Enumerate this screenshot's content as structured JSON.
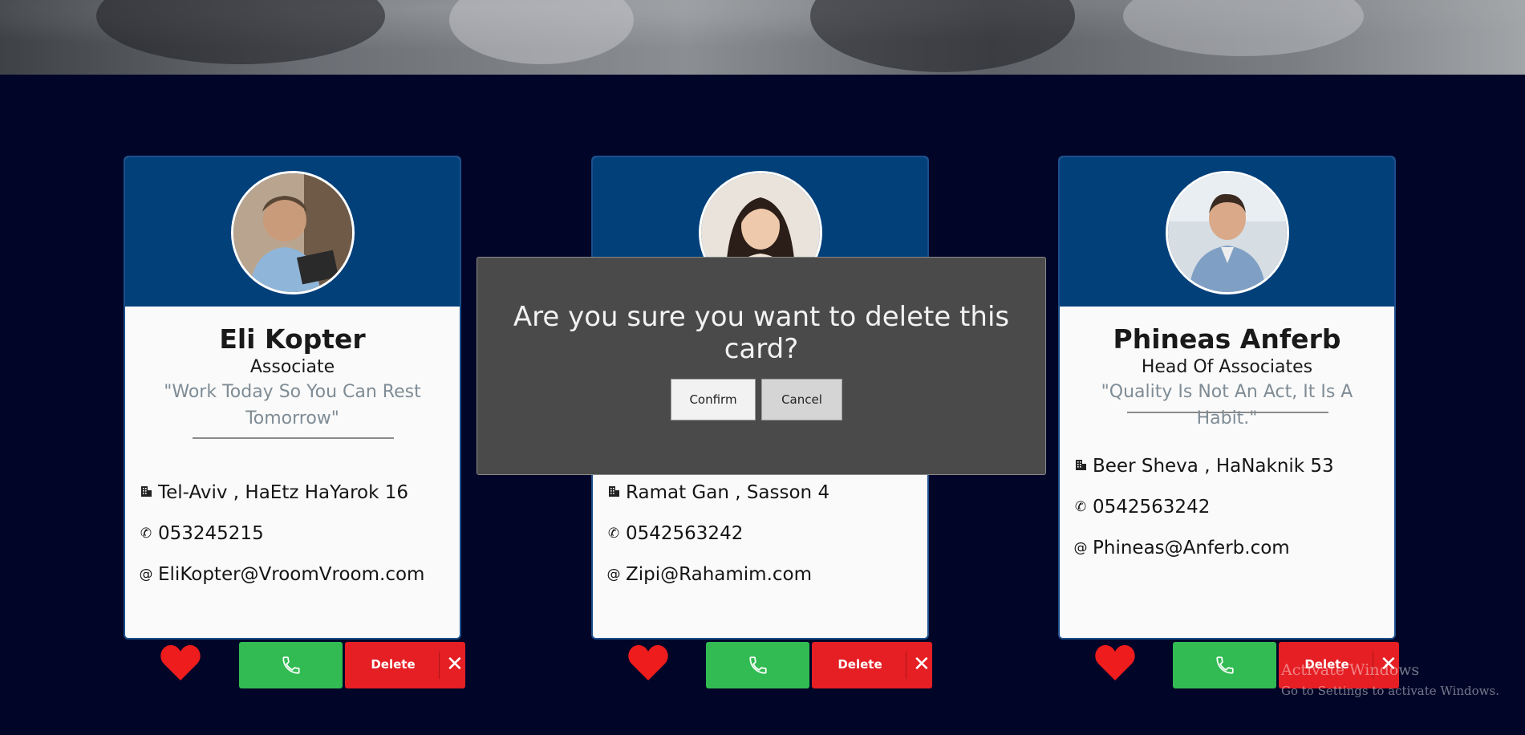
{
  "cards": [
    {
      "name": "Eli Kopter",
      "title": "Associate",
      "quote": "\"Work Today So You Can Rest Tomorrow\"",
      "address": "Tel-Aviv , HaEtz HaYarok 16",
      "phone": "053245215",
      "email": "EliKopter@VroomVroom.com",
      "delete_label": "Delete"
    },
    {
      "name": "",
      "title": "",
      "quote": "",
      "address": "Ramat Gan , Sasson 4",
      "phone": "0542563242",
      "email": "Zipi@Rahamim.com",
      "delete_label": "Delete"
    },
    {
      "name": "Phineas Anferb",
      "title": "Head Of Associates",
      "quote": "\"Quality Is Not An Act, It Is A Habit.\"",
      "address": "Beer Sheva , HaNaknik 53",
      "phone": "0542563242",
      "email": "Phineas@Anferb.com",
      "delete_label": "Delete"
    }
  ],
  "dialog": {
    "question": "Are you sure you want to delete this card?",
    "confirm_label": "Confirm",
    "cancel_label": "Cancel"
  },
  "watermark": {
    "line1": "Activate Windows",
    "line2": "Go to Settings to activate Windows."
  },
  "icons": {
    "address": "building-icon",
    "phone": "phone-icon",
    "email": "at-icon",
    "favorite": "heart-icon",
    "call": "phone-icon",
    "remove": "close-icon"
  },
  "colors": {
    "background": "#010628",
    "card_band": "#02407a",
    "call_button": "#31bb52",
    "delete_button": "#e51f24",
    "heart": "#ee1c1c",
    "dialog": "#4a4a4a"
  }
}
